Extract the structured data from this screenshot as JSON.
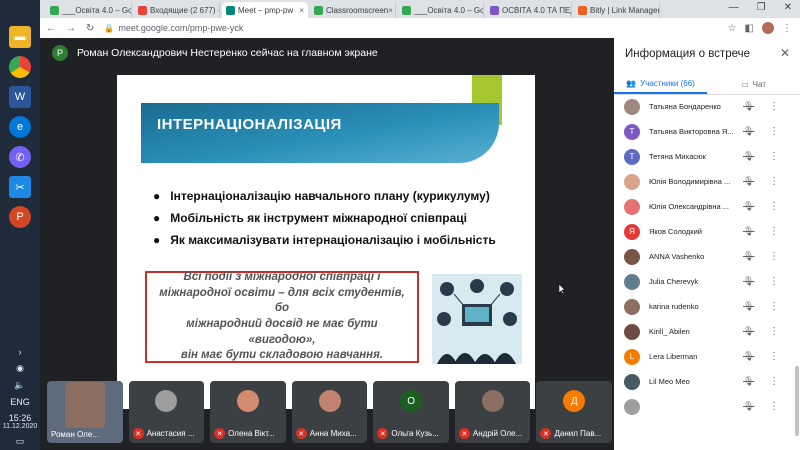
{
  "browser": {
    "tabs": [
      {
        "label": "___Освіта 4.0 – Goo",
        "color": "#34a853",
        "active": false
      },
      {
        "label": "Входящие (2 677) - k",
        "color": "#ea4335",
        "active": false
      },
      {
        "label": "Meet – pmp-pw",
        "color": "#00897b",
        "active": true
      },
      {
        "label": "Classroomscreen",
        "color": "#34a853",
        "active": false
      },
      {
        "label": "___Освіта 4.0 – Goo",
        "color": "#34a853",
        "active": false
      },
      {
        "label": "ОСВІТА 4.0 ТА ПЕДА",
        "color": "#7e57c2",
        "active": false
      },
      {
        "label": "Bitly | Link Managem",
        "color": "#ee6123",
        "active": false
      }
    ],
    "url": "meet.google.com/pmp-pwe-yck"
  },
  "taskbar": {
    "language": "ENG",
    "time": "15:26",
    "date": "11.12.2020"
  },
  "meet": {
    "presenter_initial": "Р",
    "presenter_text": "Роман Олександрович Нестеренко сейчас на главном экране",
    "slide": {
      "title": "ІНТЕРНАЦІОНАЛІЗАЦІЯ",
      "bullets": [
        "Інтернаціоналізацію навчального плану (курикулуму)",
        "Мобільність як інструмент міжнародної співпраці",
        "Як максималізувати інтернаціоналізацію і мобільність"
      ],
      "quote_line1": "Всі події з міжнародної співпраці і",
      "quote_line2": "міжнародної освіти – для  всіх студентів, бо",
      "quote_line3": "міжнародний досвід не має бути «вигодою»,",
      "quote_line4": "він має бути складовою навчання."
    },
    "thumbnails": [
      {
        "name": "Роман Оле...",
        "muted": false,
        "avatar_color": "#5d6a7d",
        "initial": ""
      },
      {
        "name": "Анастасия ...",
        "muted": true,
        "avatar_color": "#9e9e9e",
        "initial": ""
      },
      {
        "name": "Олена Вікт...",
        "muted": true,
        "avatar_color": "#d48a6f",
        "initial": ""
      },
      {
        "name": "Анна Миха...",
        "muted": true,
        "avatar_color": "#c28270",
        "initial": ""
      },
      {
        "name": "Ольга Кузь...",
        "muted": true,
        "avatar_color": "#1b5e20",
        "initial": "О"
      },
      {
        "name": "Андрій Оле...",
        "muted": true,
        "avatar_color": "#8d6e63",
        "initial": ""
      },
      {
        "name": "Данил Пав...",
        "muted": true,
        "avatar_color": "#f57c00",
        "initial": "Д"
      }
    ]
  },
  "panel": {
    "title": "Информация о встрече",
    "participants_tab": "Участники (66)",
    "chat_tab": "Чат",
    "participants": [
      {
        "name": "Татьяна Бондаренко",
        "initial": "",
        "color": "#a1887f"
      },
      {
        "name": "Татьяна Викторовна Я...",
        "initial": "Т",
        "color": "#7e57c2"
      },
      {
        "name": "Тетяна Михасюк",
        "initial": "Т",
        "color": "#5c6bc0"
      },
      {
        "name": "Юлія Володимирівна ...",
        "initial": "",
        "color": "#d7a38b"
      },
      {
        "name": "Юлія Олександрівна ...",
        "initial": "",
        "color": "#e57373"
      },
      {
        "name": "Яков Солодкий",
        "initial": "Я",
        "color": "#e53935"
      },
      {
        "name": "ANNA Vashenko",
        "initial": "",
        "color": "#795548"
      },
      {
        "name": "Julia Cherevyk",
        "initial": "",
        "color": "#607d8b"
      },
      {
        "name": "karina rudenko",
        "initial": "",
        "color": "#8d6e63"
      },
      {
        "name": "Kirill_ Abilen",
        "initial": "",
        "color": "#6d4c41"
      },
      {
        "name": "Lera Liberman",
        "initial": "L",
        "color": "#f57c00"
      },
      {
        "name": "Lil Meo Meo",
        "initial": "",
        "color": "#455a64"
      },
      {
        "name": "",
        "initial": "",
        "color": "#9e9e9e"
      }
    ]
  }
}
